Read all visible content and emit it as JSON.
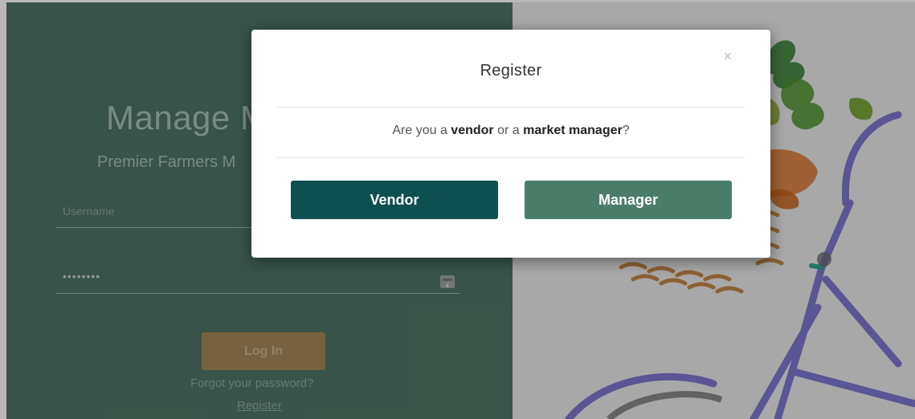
{
  "background": {
    "title": "Manage M",
    "subtitle": "Premier Farmers M",
    "username_placeholder": "Username",
    "password_mask": "••••••••",
    "login_label": "Log In",
    "forgot_label": "Forgot your password?",
    "register_label": "Register"
  },
  "modal": {
    "title": "Register",
    "close_symbol": "×",
    "question": {
      "prefix": "Are you a ",
      "option1": "vendor",
      "middle": " or a ",
      "option2": "market manager",
      "suffix": "?"
    },
    "buttons": {
      "vendor": "Vendor",
      "manager": "Manager"
    }
  },
  "colors": {
    "left_panel": "#507467",
    "vendor_button": "#0e4f4f",
    "manager_button": "#4a7e6b",
    "login_button": "#a58859"
  },
  "icons": {
    "close": "close-icon",
    "password_manager": "password-manager-icon",
    "illustration": "bicycle-watercolor-illustration"
  }
}
